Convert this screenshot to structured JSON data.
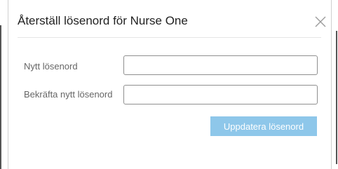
{
  "dialog": {
    "title": "Återställ lösenord för Nurse One",
    "close_icon": "close-icon"
  },
  "form": {
    "new_password_label": "Nytt lösenord",
    "new_password_value": "",
    "confirm_password_label": "Bekräfta nytt lösenord",
    "confirm_password_value": "",
    "submit_label": "Uppdatera lösenord"
  },
  "colors": {
    "button_background": "#8ec7ea",
    "button_text": "#ffffff",
    "input_border": "#8f8f8f",
    "title_text": "#222222",
    "label_text": "#666666"
  }
}
